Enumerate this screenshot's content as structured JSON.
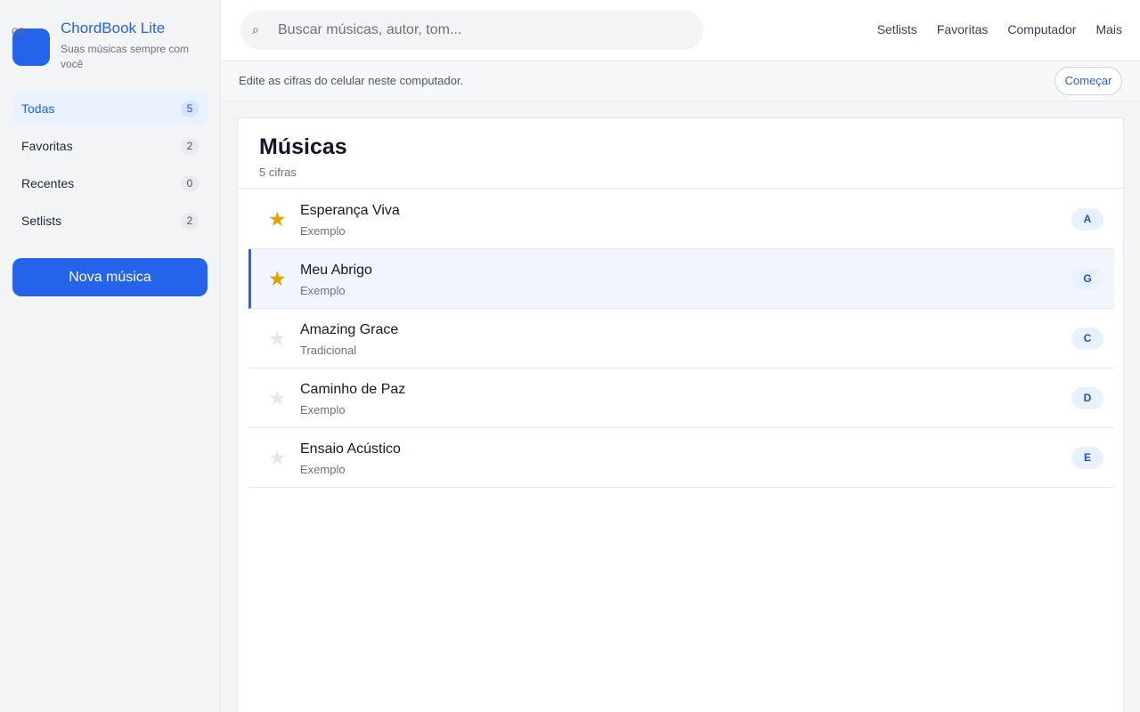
{
  "app": {
    "logo_text": "CB",
    "title": "ChordBook Lite",
    "subtitle": "Suas músicas sempre com você"
  },
  "sidebar": {
    "items": [
      {
        "label": "Todas",
        "count": "5"
      },
      {
        "label": "Favoritas",
        "count": "2"
      },
      {
        "label": "Recentes",
        "count": "0"
      },
      {
        "label": "Setlists",
        "count": "2"
      }
    ],
    "new_button": "Nova música"
  },
  "search": {
    "icon": "search-icon",
    "placeholder": "Buscar músicas, autor, tom..."
  },
  "topnav": [
    "Setlists",
    "Favoritas",
    "Computador",
    "Mais"
  ],
  "banner": {
    "text": "Edite as cifras do celular neste computador.",
    "button": "Começar"
  },
  "main": {
    "title": "Músicas",
    "subtitle": "5 cifras",
    "songs": [
      {
        "title": "Esperança Viva",
        "artist": "Exemplo",
        "key": "A",
        "favorite": true
      },
      {
        "title": "Meu Abrigo",
        "artist": "Exemplo",
        "key": "G",
        "favorite": true
      },
      {
        "title": "Amazing Grace",
        "artist": "Tradicional",
        "key": "C",
        "favorite": false
      },
      {
        "title": "Caminho de Paz",
        "artist": "Exemplo",
        "key": "D",
        "favorite": false
      },
      {
        "title": "Ensaio Acústico",
        "artist": "Exemplo",
        "key": "E",
        "favorite": false
      }
    ],
    "star_glyph": "★"
  },
  "colors": {
    "accent": "#2563eb",
    "favorite": "#e0a300",
    "selected_row": "#f1f6fe"
  }
}
